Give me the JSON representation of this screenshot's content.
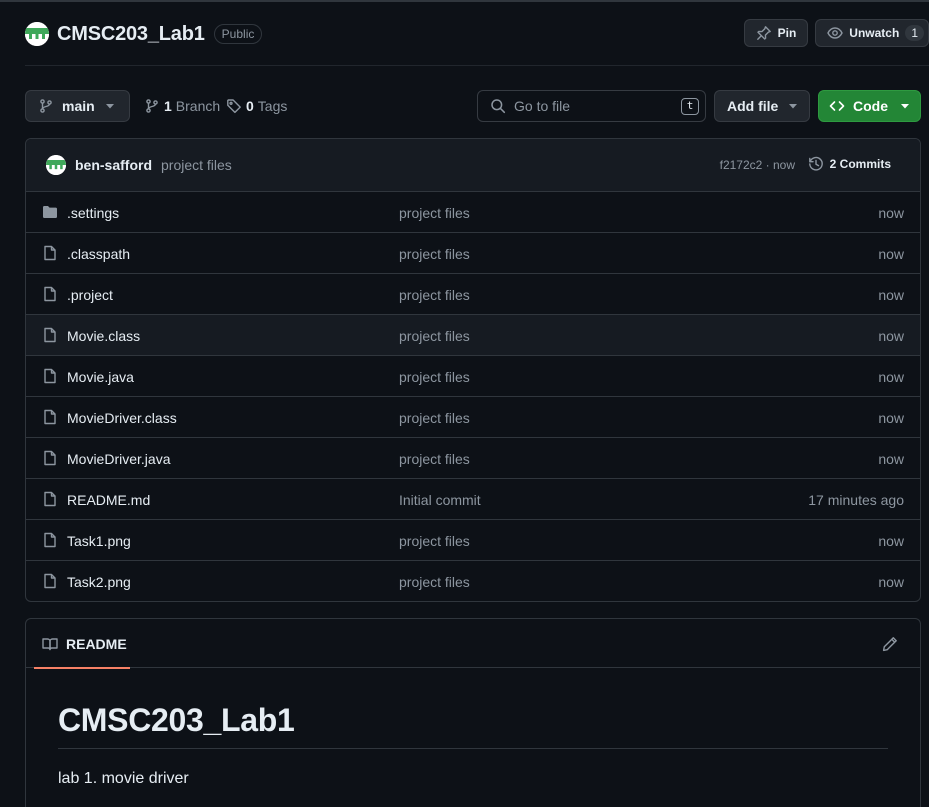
{
  "repo": {
    "name": "CMSC203_Lab1",
    "visibility": "Public"
  },
  "header_actions": {
    "pin_label": "Pin",
    "unwatch_label": "Unwatch",
    "watch_count": "1"
  },
  "branch_bar": {
    "branch": "main",
    "branch_count": "1",
    "branch_label": "Branch",
    "tag_count": "0",
    "tag_label": "Tags",
    "search_placeholder": "Go to file",
    "search_shortcut": "t",
    "add_file_label": "Add file",
    "code_label": "Code"
  },
  "latest_commit": {
    "author": "ben-safford",
    "message": "project files",
    "meta": "f2172c2 · now",
    "commits_count_label": "2 Commits"
  },
  "files": [
    {
      "name": ".settings",
      "type": "folder",
      "commit": "project files",
      "age": "now",
      "icon": "folder-icon"
    },
    {
      "name": ".classpath",
      "type": "file",
      "commit": "project files",
      "age": "now",
      "icon": "file-icon"
    },
    {
      "name": ".project",
      "type": "file",
      "commit": "project files",
      "age": "now",
      "icon": "file-icon"
    },
    {
      "name": "Movie.class",
      "type": "file",
      "commit": "project files",
      "age": "now",
      "icon": "file-icon"
    },
    {
      "name": "Movie.java",
      "type": "file",
      "commit": "project files",
      "age": "now",
      "icon": "file-icon"
    },
    {
      "name": "MovieDriver.class",
      "type": "file",
      "commit": "project files",
      "age": "now",
      "icon": "file-icon"
    },
    {
      "name": "MovieDriver.java",
      "type": "file",
      "commit": "project files",
      "age": "now",
      "icon": "file-icon"
    },
    {
      "name": "README.md",
      "type": "file",
      "commit": "Initial commit",
      "age": "17 minutes ago",
      "icon": "file-icon"
    },
    {
      "name": "Task1.png",
      "type": "file",
      "commit": "project files",
      "age": "now",
      "icon": "file-icon"
    },
    {
      "name": "Task2.png",
      "type": "file",
      "commit": "project files",
      "age": "now",
      "icon": "file-icon"
    }
  ],
  "readme": {
    "tab_label": "README",
    "title": "CMSC203_Lab1",
    "body": "lab 1. movie driver"
  },
  "colors": {
    "background": "#0d1117",
    "code_button": "#238636",
    "tab_underline": "#f78166",
    "muted_text": "#8d96a0"
  }
}
